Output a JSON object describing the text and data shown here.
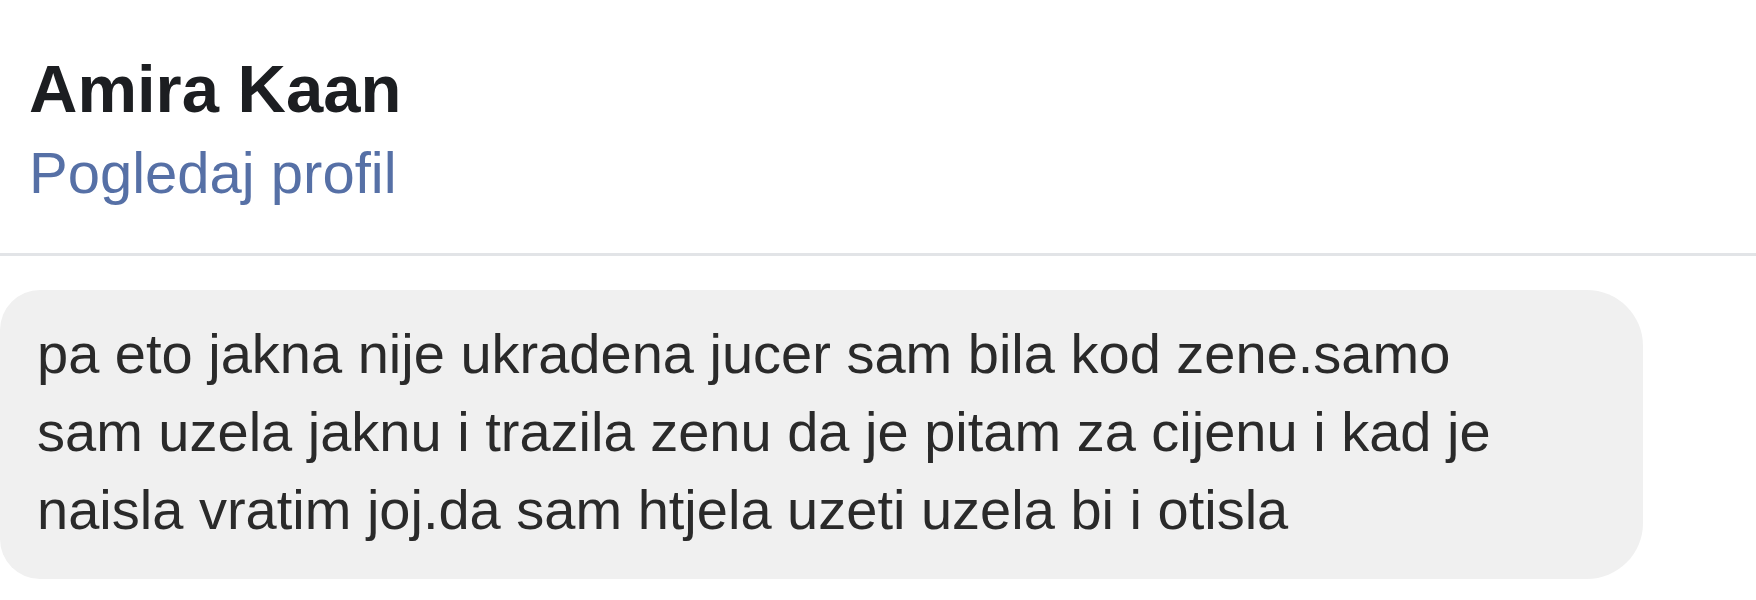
{
  "profile": {
    "name": "Amira Kaan",
    "link": "Pogledaj profil"
  },
  "message": {
    "text": "pa eto jakna nije ukradena jucer sam bila kod zene.samo sam uzela jaknu i trazila zenu da je pitam za cijenu i kad je naisla vratim joj.da sam htjela uzeti uzela bi i otisla"
  }
}
